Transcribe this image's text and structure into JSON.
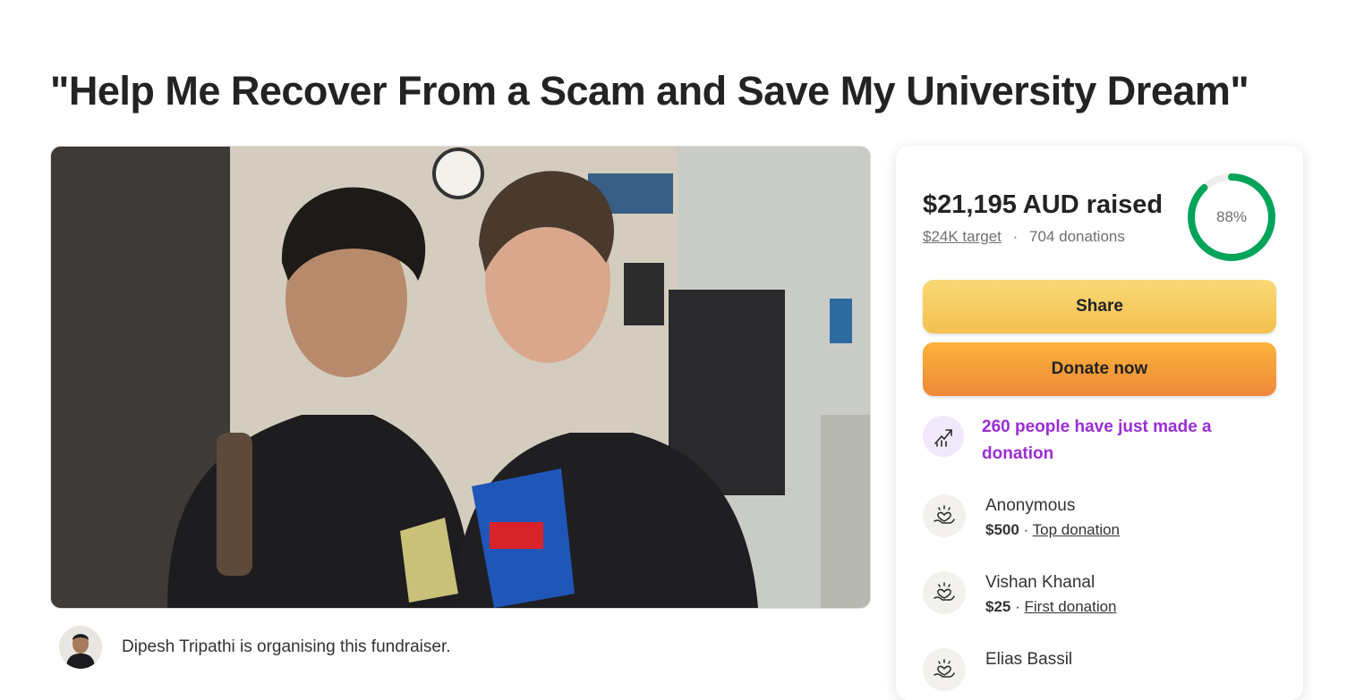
{
  "title": "\"Help Me Recover From a Scam and Save My University Dream\"",
  "organiser": {
    "text": "Dipesh Tripathi is organising this fundraiser."
  },
  "donation_card": {
    "raised": "$21,195 AUD raised",
    "target": "$24K target",
    "separator": "·",
    "donations": "704 donations",
    "progress_percent": 88,
    "progress_label": "88%",
    "share_label": "Share",
    "donate_label": "Donate now",
    "momentum": "260 people have just made a donation",
    "donors": [
      {
        "name": "Anonymous",
        "amount": "$500",
        "tag": "Top donation"
      },
      {
        "name": "Vishan Khanal",
        "amount": "$25",
        "tag": "First donation"
      },
      {
        "name": "Elias Bassil"
      }
    ]
  },
  "colors": {
    "progress": "#00a35a",
    "share_button": "#f6cd60",
    "donate_button": "#f4a033",
    "momentum_text": "#9a2dd6"
  },
  "icons": {
    "momentum": "trending-up-icon",
    "donor": "heart-hand-icon"
  }
}
